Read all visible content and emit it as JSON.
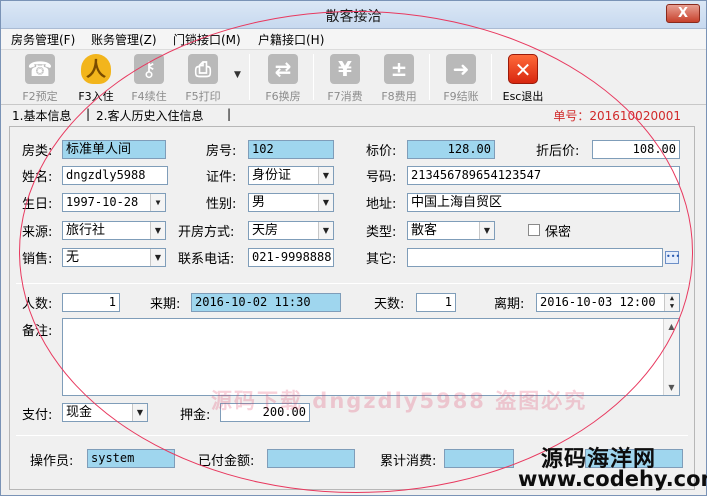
{
  "window": {
    "title": "散客接洽",
    "close_label": "X"
  },
  "menu": [
    "房务管理(F)",
    "账务管理(Z)",
    "门锁接口(M)",
    "户籍接口(H)"
  ],
  "toolbar": {
    "buttons": [
      {
        "label": "F2预定",
        "icon": "phone-icon",
        "enabled": false
      },
      {
        "label": "F3入住",
        "icon": "person-icon",
        "enabled": true
      },
      {
        "label": "F4续住",
        "icon": "key-icon",
        "enabled": false
      },
      {
        "label": "F5打印",
        "icon": "printer-icon",
        "enabled": false
      },
      {
        "label": "F6换房",
        "icon": "room-swap-icon",
        "enabled": false
      },
      {
        "label": "F7消费",
        "icon": "consume-icon",
        "enabled": false
      },
      {
        "label": "F8费用",
        "icon": "calculator-icon",
        "enabled": false
      },
      {
        "label": "F9结账",
        "icon": "checkout-icon",
        "enabled": false
      },
      {
        "label": "Esc退出",
        "icon": "exit-icon",
        "enabled": true
      }
    ]
  },
  "tabs": [
    "1.基本信息",
    "2.客人历史入住信息"
  ],
  "order": {
    "label": "单号：",
    "value": "201610020001"
  },
  "form": {
    "room_type": {
      "label": "房类:",
      "value": "标准单人间"
    },
    "room_no": {
      "label": "房号:",
      "value": "102"
    },
    "list_price": {
      "label": "标价:",
      "value": "128.00"
    },
    "discount_price": {
      "label": "折后价:",
      "value": "108.00"
    },
    "name": {
      "label": "姓名:",
      "value": "dngzdly5988"
    },
    "id_type": {
      "label": "证件:",
      "value": "身份证"
    },
    "id_number": {
      "label": "号码:",
      "value": "213456789654123547"
    },
    "birthday": {
      "label": "生日:",
      "value": "1997-10-28"
    },
    "gender": {
      "label": "性别:",
      "value": "男"
    },
    "address": {
      "label": "地址:",
      "value": "中国上海自贸区"
    },
    "source": {
      "label": "来源:",
      "value": "旅行社"
    },
    "open_mode": {
      "label": "开房方式:",
      "value": "天房"
    },
    "guest_type": {
      "label": "类型:",
      "value": "散客"
    },
    "confidential": {
      "label": "保密",
      "checked": false
    },
    "sales": {
      "label": "销售:",
      "value": "无"
    },
    "phone": {
      "label": "联系电话:",
      "value": "021-9998888"
    },
    "other": {
      "label": "其它:",
      "value": ""
    },
    "guests": {
      "label": "人数:",
      "value": "1"
    },
    "arrive": {
      "label": "来期:",
      "value": "2016-10-02 11:30"
    },
    "days": {
      "label": "天数:",
      "value": "1"
    },
    "depart": {
      "label": "离期:",
      "value": "2016-10-03 12:00"
    },
    "remark": {
      "label": "备注:",
      "value": ""
    },
    "payment": {
      "label": "支付:",
      "value": "现金"
    },
    "deposit": {
      "label": "押金:",
      "value": "200.00"
    }
  },
  "footer": {
    "operator": {
      "label": "操作员:",
      "value": "system"
    },
    "paid": {
      "label": "已付金额:",
      "value": ""
    },
    "total": {
      "label": "累计消费:",
      "value": ""
    }
  },
  "watermark": {
    "center_text": "源码下载 dngzdly5988 盗图必究",
    "brand": "源码海洋网",
    "url": "www.codehy.com"
  },
  "colors": {
    "highlight_field": "#9fd6ee",
    "order_number": "#d12a2a",
    "oval": "#e8395f"
  }
}
